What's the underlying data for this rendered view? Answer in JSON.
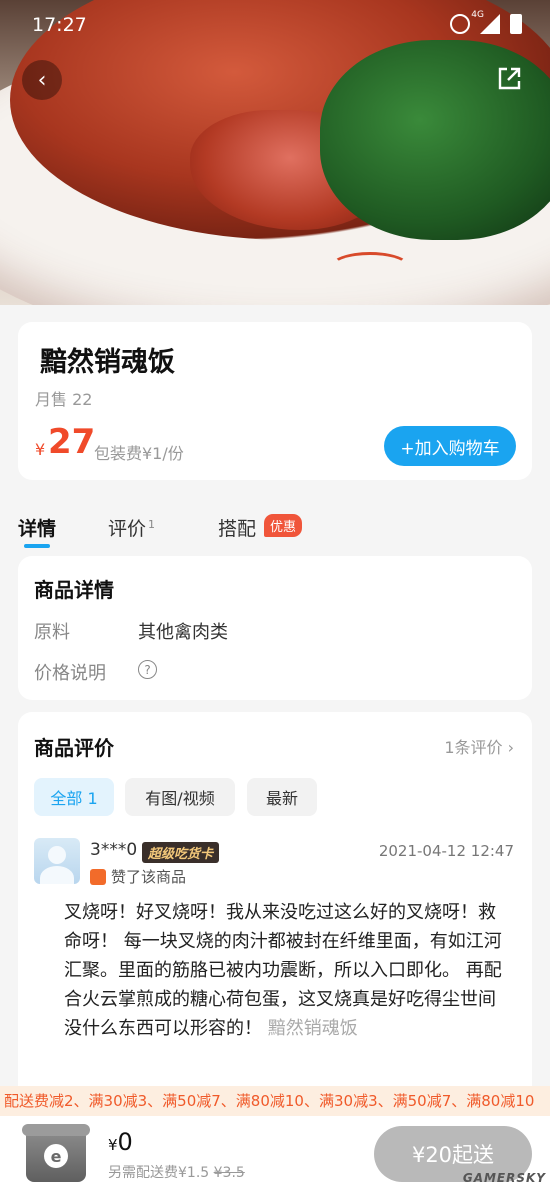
{
  "status_bar": {
    "time": "17:27",
    "network": "4G"
  },
  "product": {
    "title": "黯然销魂饭",
    "monthly_sales": "月售 22",
    "currency": "¥",
    "price": "27",
    "packaging_fee": "包装费¥1/份",
    "add_to_cart_label": "+加入购物车"
  },
  "tabs": {
    "detail": "详情",
    "review": "评价",
    "review_count": "1",
    "combo": "搭配",
    "combo_badge": "优惠"
  },
  "details": {
    "title": "商品详情",
    "ingredients_label": "原料",
    "ingredients_value": "其他禽肉类",
    "price_note_label": "价格说明",
    "help_icon_text": "?"
  },
  "reviews": {
    "title": "商品评价",
    "count_link": "1条评价",
    "filters": [
      "全部 1",
      "有图/视频",
      "最新"
    ],
    "item": {
      "user": "3***0",
      "badge": "超级吃货卡",
      "date": "2021-04-12 12:47",
      "liked_text": "赞了该商品",
      "text": "叉烧呀！好叉烧呀！我从来没吃过这么好的叉烧呀！救命呀！ 每一块叉烧的肉汁都被封在纤维里面，有如江河汇聚。里面的筋胳已被内功震断，所以入口即化。 再配合火云掌煎成的糖心荷包蛋，这叉烧真是好吃得尘世间没什么东西可以形容的！ ",
      "dish": "黯然销魂饭"
    }
  },
  "promo_strip": "配送费减2、满30减3、满50减7、满80减10、满30减3、满50减7、满80减10",
  "bottom_bar": {
    "total_currency": "¥",
    "total": "0",
    "delivery_prefix": "另需配送费¥1.5 ",
    "delivery_original": "¥3.5",
    "checkout_label": "¥20起送",
    "watermark": "GAMERSKY"
  },
  "colors": {
    "accent": "#1aa4f0",
    "price": "#f04a2a",
    "promo": "#f05a2a"
  }
}
